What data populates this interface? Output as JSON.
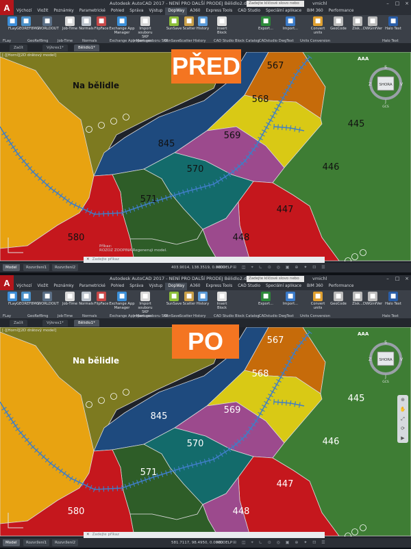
{
  "app": {
    "logo": "A",
    "title": "Autodesk AutoCAD 2017 - NENÍ PRO DALŠÍ PRODEJ    Bělidlo2.dwg",
    "search_placeholder": "Zadejte klíčové slovo nebo výraz",
    "user": "vmichl"
  },
  "menu": [
    "Výchozí",
    "Vložit",
    "Poznámky",
    "Parametrické",
    "Pohled",
    "Správa",
    "Výstup",
    "DopWay",
    "A360",
    "Express Tools",
    "CAD Studio",
    "Speciální aplikace",
    "BIM 360",
    "Performance"
  ],
  "menu_active": "DopWay",
  "ribbon": {
    "buttons": [
      "FLay",
      "GEOREF8MG",
      "WORLDOUT",
      "Job-Time",
      "Normals",
      "FlipFace",
      "Exchange App Manager",
      "Import souboru SKP",
      "SunSave",
      "Scatter",
      "History",
      "Insert Block",
      "Export...",
      "Import...",
      "Convert units",
      "GeoCode",
      "Zisk...",
      "DWGinfVer",
      "Halo Text"
    ],
    "groups": [
      "FLay",
      "GeoRef8mg",
      "Job-Time",
      "Normals",
      "Exchange App Manager",
      "Import souboru SKP",
      "SunSave",
      "Scatter",
      "History",
      "CAD Studio Block Catalog",
      "CADstudio DwgText",
      "Units Conversion",
      "Halo Text"
    ]
  },
  "doc_tabs": [
    "Začít",
    "Výkres1*",
    "Bělidlo1*"
  ],
  "doc_tab_active": "Bělidlo1*",
  "viewport_label": "[-][Horní][2D drátový model]",
  "viewcube": {
    "top": "S",
    "bottom": "J",
    "left": "Z",
    "right": "V",
    "face": "SHORA",
    "wcs": "GCS"
  },
  "aaa_label": "AAA",
  "map": {
    "area_name": "Na bělidle",
    "parcels": [
      "567",
      "568",
      "569",
      "445",
      "845",
      "570",
      "446",
      "571",
      "447",
      "580",
      "448"
    ],
    "colors": {
      "olive": "#7d7a20",
      "orange": "#e8a311",
      "blue": "#1e4a7e",
      "darkorange": "#c66b0a",
      "yellow": "#d9c915",
      "magenta": "#9c4a8d",
      "green": "#3e7d34",
      "teal": "#136b6b",
      "darkgreen": "#2e5d28",
      "red": "#c5171d"
    }
  },
  "panels": [
    {
      "banner": "PŘED",
      "cmd_history": [
        "Příkaz:",
        "ROZOZ  ZOOPINA Regeneruji model."
      ],
      "cmd_placeholder": "Zadejte příkaz",
      "coords": "403.9014, 138.3519, 0.0000",
      "model_label": "MODELP"
    },
    {
      "banner": "PO",
      "cmd_history": [],
      "cmd_placeholder": "Zadejte příkaz",
      "coords": "581.7117, 98.4950, 0.0000",
      "model_label": "MODELP"
    }
  ],
  "status_tabs": [
    "Model",
    "Rozvržení1",
    "Rozvržení2"
  ],
  "status_tab_active": "Model"
}
